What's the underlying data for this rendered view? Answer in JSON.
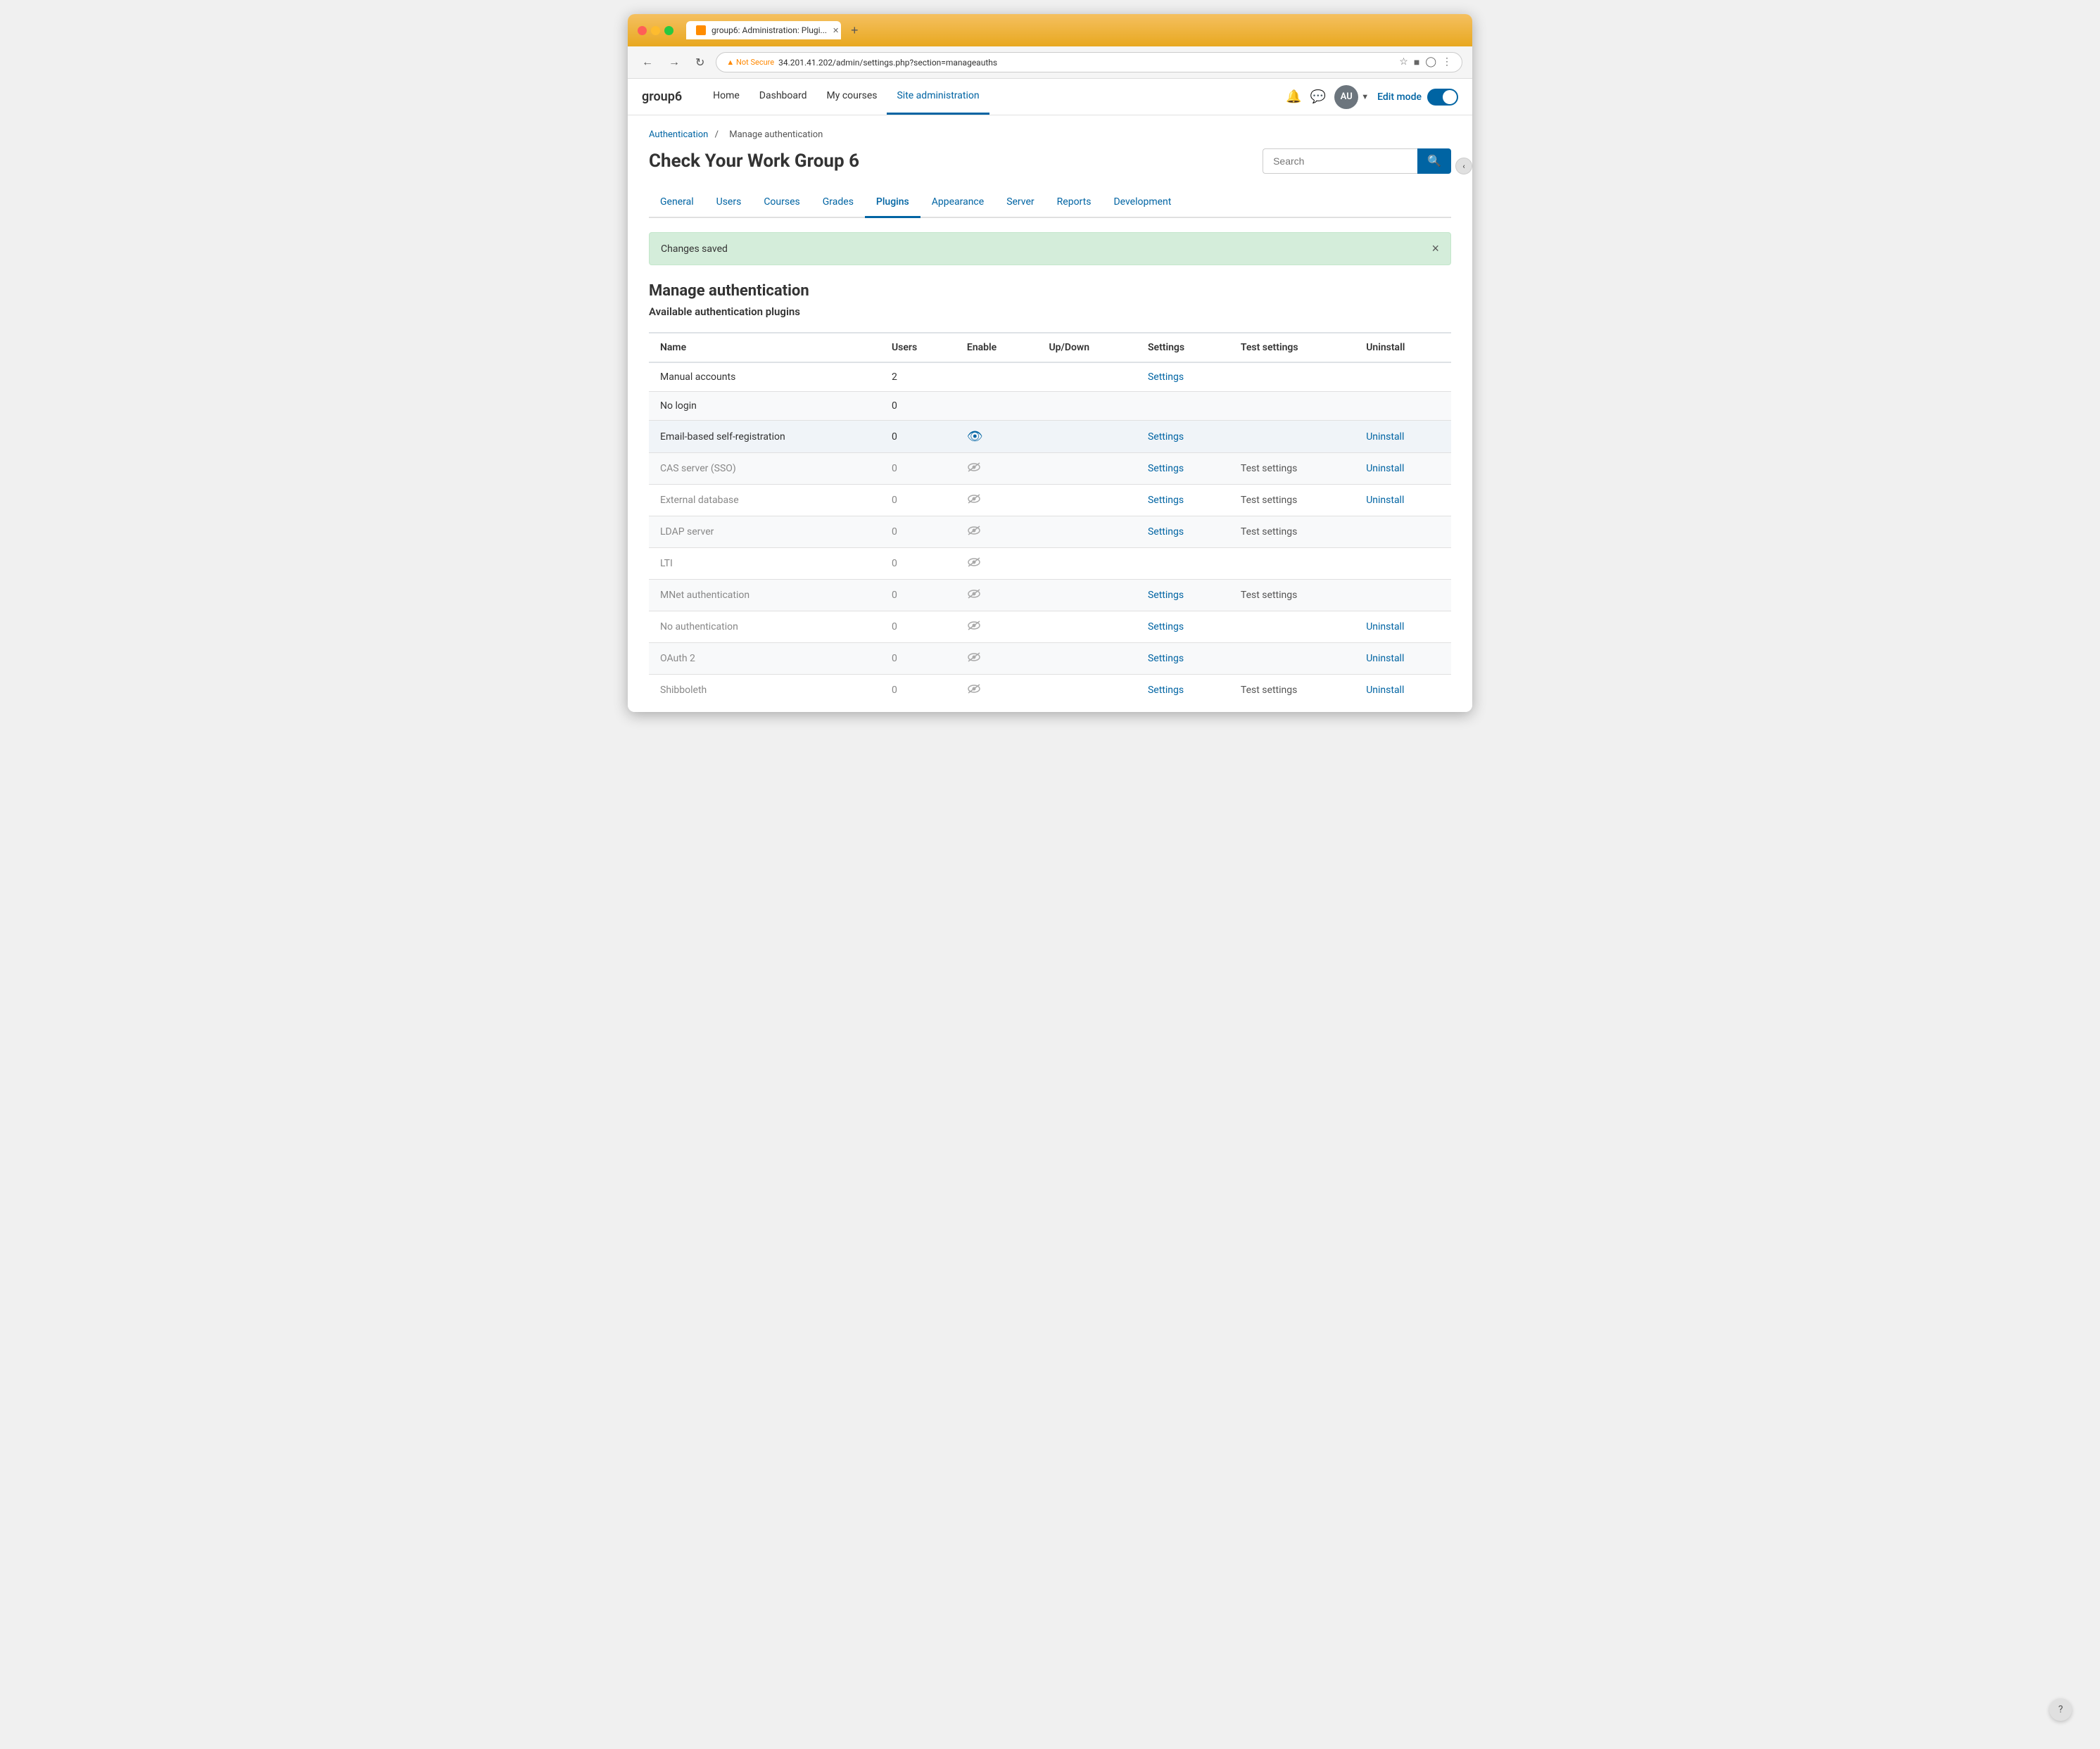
{
  "browser": {
    "tab_label": "group6: Administration: Plugi...",
    "url": "34.201.41.202/admin/settings.php?section=manageauths",
    "url_warning": "Not Secure",
    "new_tab_icon": "+"
  },
  "topnav": {
    "site_name": "group6",
    "nav_items": [
      {
        "label": "Home",
        "active": false
      },
      {
        "label": "Dashboard",
        "active": false
      },
      {
        "label": "My courses",
        "active": false
      },
      {
        "label": "Site administration",
        "active": true
      }
    ],
    "user_initials": "AU",
    "edit_mode_label": "Edit mode"
  },
  "breadcrumb": {
    "parent_label": "Authentication",
    "parent_href": "#",
    "separator": "/",
    "current": "Manage authentication"
  },
  "page": {
    "title": "Check Your Work Group 6",
    "search_placeholder": "Search",
    "search_value": ""
  },
  "subtabs": [
    {
      "label": "General",
      "active": false
    },
    {
      "label": "Users",
      "active": false
    },
    {
      "label": "Courses",
      "active": false
    },
    {
      "label": "Grades",
      "active": false
    },
    {
      "label": "Plugins",
      "active": true
    },
    {
      "label": "Appearance",
      "active": false
    },
    {
      "label": "Server",
      "active": false
    },
    {
      "label": "Reports",
      "active": false
    },
    {
      "label": "Development",
      "active": false
    }
  ],
  "alert": {
    "message": "Changes saved"
  },
  "section": {
    "title": "Manage authentication",
    "subtitle": "Available authentication plugins"
  },
  "table": {
    "headers": [
      "Name",
      "Users",
      "Enable",
      "Up/Down",
      "Settings",
      "Test settings",
      "Uninstall"
    ],
    "rows": [
      {
        "name": "Manual accounts",
        "users": "2",
        "enable": "",
        "updown": "",
        "settings": "Settings",
        "test_settings": "",
        "uninstall": "",
        "enabled": true,
        "has_settings": true,
        "has_uninstall": false,
        "has_test": false
      },
      {
        "name": "No login",
        "users": "0",
        "enable": "",
        "updown": "",
        "settings": "",
        "test_settings": "",
        "uninstall": "",
        "enabled": true,
        "has_settings": false,
        "has_uninstall": false,
        "has_test": false
      },
      {
        "name": "Email-based self-registration",
        "users": "0",
        "enable": "eye-on",
        "updown": "",
        "settings": "Settings",
        "test_settings": "",
        "uninstall": "Uninstall",
        "enabled": true,
        "has_settings": true,
        "has_uninstall": true,
        "has_test": false,
        "highlight": true
      },
      {
        "name": "CAS server (SSO)",
        "users": "0",
        "enable": "eye-off",
        "updown": "",
        "settings": "Settings",
        "test_settings": "Test settings",
        "uninstall": "Uninstall",
        "enabled": false,
        "has_settings": true,
        "has_uninstall": true,
        "has_test": true
      },
      {
        "name": "External database",
        "users": "0",
        "enable": "eye-off",
        "updown": "",
        "settings": "Settings",
        "test_settings": "Test settings",
        "uninstall": "Uninstall",
        "enabled": false,
        "has_settings": true,
        "has_uninstall": true,
        "has_test": true
      },
      {
        "name": "LDAP server",
        "users": "0",
        "enable": "eye-off",
        "updown": "",
        "settings": "Settings",
        "test_settings": "Test settings",
        "uninstall": "",
        "enabled": false,
        "has_settings": true,
        "has_uninstall": false,
        "has_test": true
      },
      {
        "name": "LTI",
        "users": "0",
        "enable": "eye-off",
        "updown": "",
        "settings": "",
        "test_settings": "",
        "uninstall": "",
        "enabled": false,
        "has_settings": false,
        "has_uninstall": false,
        "has_test": false
      },
      {
        "name": "MNet authentication",
        "users": "0",
        "enable": "eye-off",
        "updown": "",
        "settings": "Settings",
        "test_settings": "Test settings",
        "uninstall": "",
        "enabled": false,
        "has_settings": true,
        "has_uninstall": false,
        "has_test": true
      },
      {
        "name": "No authentication",
        "users": "0",
        "enable": "eye-off",
        "updown": "",
        "settings": "Settings",
        "test_settings": "",
        "uninstall": "Uninstall",
        "enabled": false,
        "has_settings": true,
        "has_uninstall": true,
        "has_test": false
      },
      {
        "name": "OAuth 2",
        "users": "0",
        "enable": "eye-off",
        "updown": "",
        "settings": "Settings",
        "test_settings": "",
        "uninstall": "Uninstall",
        "enabled": false,
        "has_settings": true,
        "has_uninstall": true,
        "has_test": false
      },
      {
        "name": "Shibboleth",
        "users": "0",
        "enable": "eye-off",
        "updown": "",
        "settings": "Settings",
        "test_settings": "Test settings",
        "uninstall": "Uninstall",
        "enabled": false,
        "has_settings": true,
        "has_uninstall": true,
        "has_test": true
      }
    ]
  },
  "help_label": "?"
}
